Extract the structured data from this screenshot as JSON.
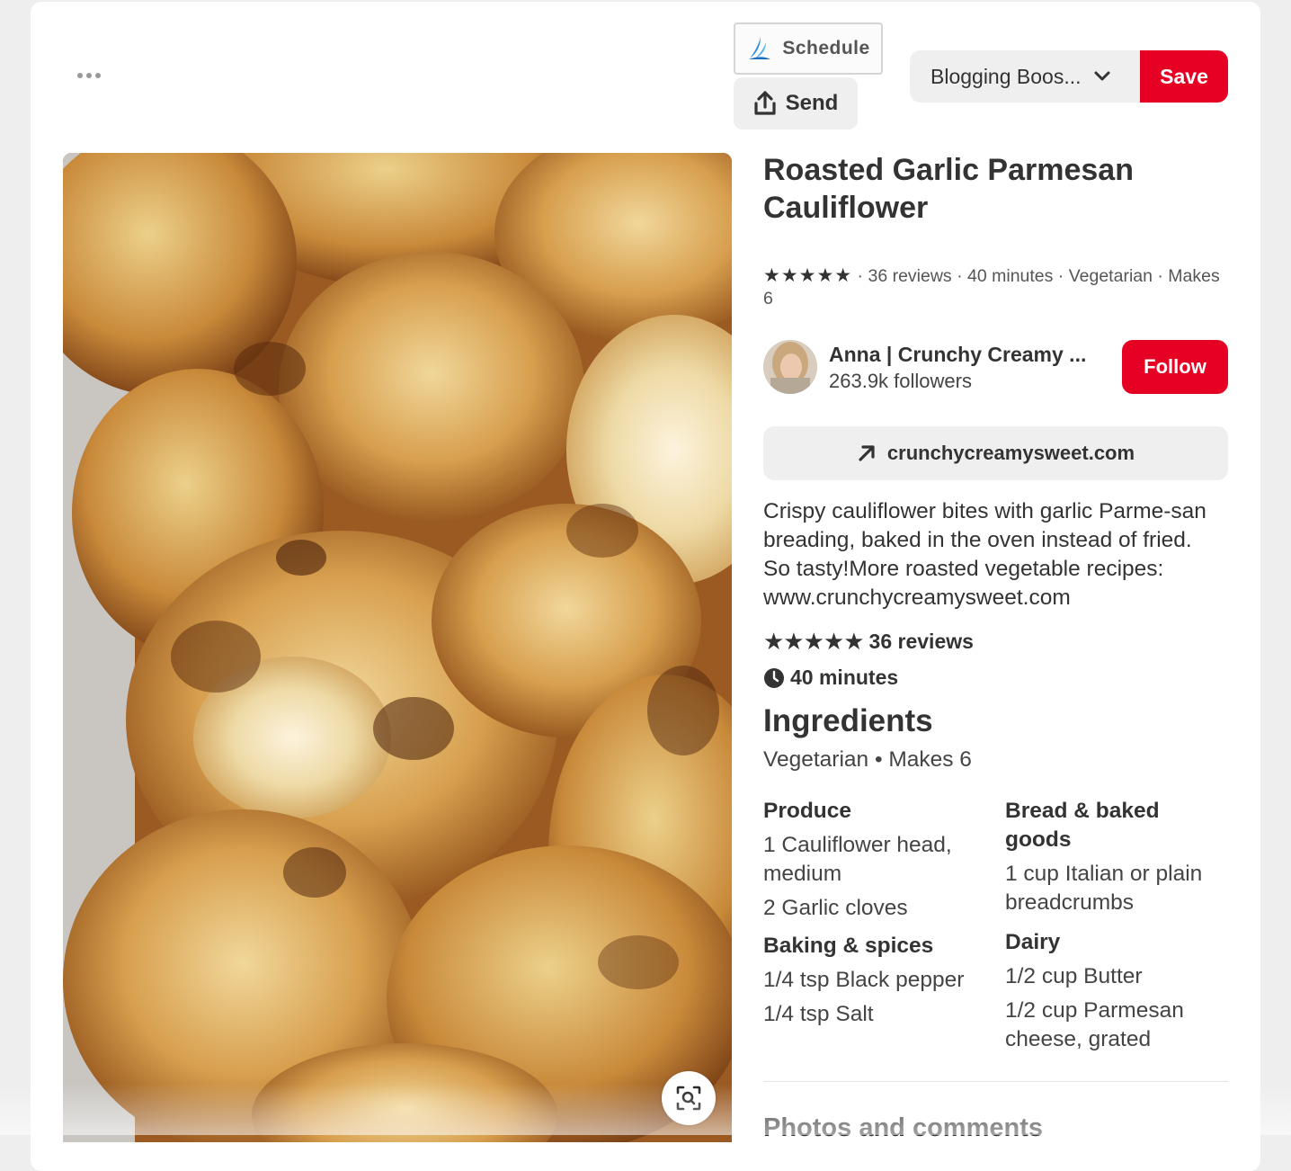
{
  "header": {
    "more_label": "More options",
    "schedule_label": "Schedule",
    "send_label": "Send",
    "board_label": "Blogging Boos...",
    "save_label": "Save"
  },
  "pin": {
    "title": "Roasted Garlic Parmesan Cauliflower",
    "meta": {
      "stars": "★★★★★",
      "text": " · 36 reviews · 40 minutes · Vegetarian · Makes 6",
      "rating": 5
    },
    "creator": {
      "name": "Anna | Crunchy Creamy ...",
      "followers": "263.9k followers",
      "follow_label": "Follow"
    },
    "link": "crunchycreamysweet.com",
    "description": "Crispy cauliflower bites with garlic Parme-san breading, baked in the oven instead of fried. So tasty!More roasted vegetable recipes: www.crunchycreamysweet.com",
    "reviews": "36 reviews",
    "reviews_stars": "★★★★★",
    "time": "40 minutes"
  },
  "ingredients": {
    "heading": "Ingredients",
    "subtitle": "Vegetarian • Makes 6",
    "left": [
      {
        "category": "Produce",
        "items": [
          "1 Cauliflower head, medium",
          "2 Garlic cloves"
        ]
      },
      {
        "category": "Baking & spices",
        "items": [
          "1/4 tsp Black pepper",
          "1/4 tsp Salt"
        ]
      }
    ],
    "right": [
      {
        "category": "Bread & baked goods",
        "items": [
          "1 cup Italian or plain breadcrumbs"
        ]
      },
      {
        "category": "Dairy",
        "items": [
          "1/2 cup Butter",
          "1/2 cup Parmesan cheese, grated"
        ]
      }
    ]
  },
  "photos_heading": "Photos and comments",
  "icons": {
    "more": "more-dots-icon",
    "schedule": "tailwind-logo-icon",
    "send": "share-upload-icon",
    "board": "chevron-down-icon",
    "link": "arrow-up-right-icon",
    "time": "clock-icon",
    "lens": "visual-search-icon"
  },
  "colors": {
    "accent": "#e60023",
    "button_bg": "#efefef",
    "text": "#333333"
  }
}
